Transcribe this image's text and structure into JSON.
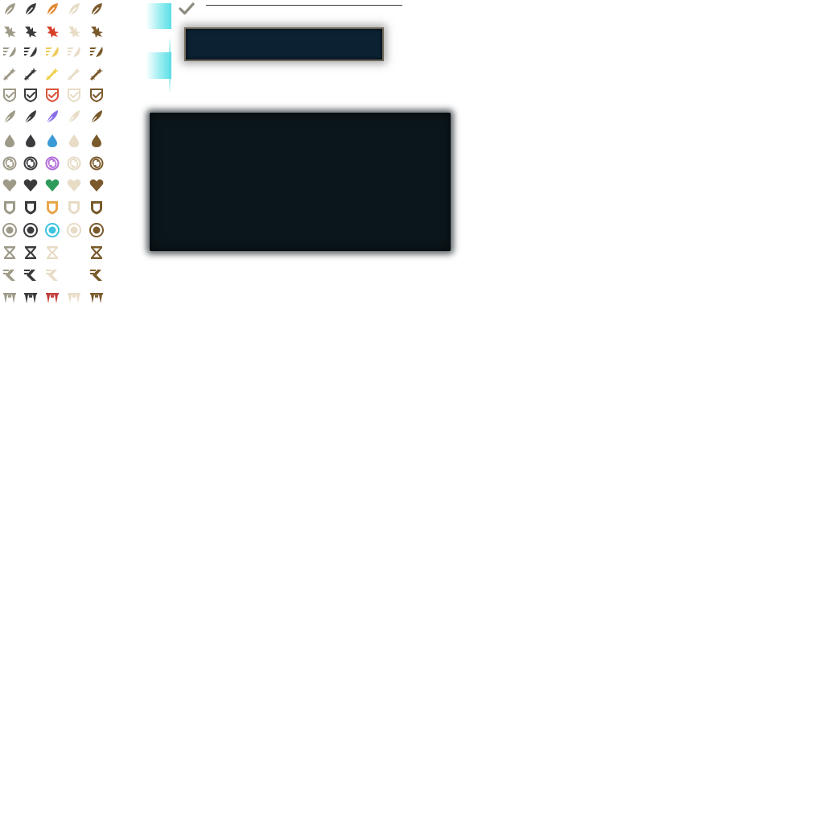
{
  "palette": {
    "tan": "#9e9a88",
    "dark": "#3b3b3e",
    "cream": "#e8dcc6",
    "brown": "#7a5a2c",
    "cyan": "#5fdde6",
    "panel_blue": "#0c2233",
    "panel_dark": "#0b161b"
  },
  "icon_rows": [
    {
      "name": "feather-quill",
      "colors": [
        "#9e9a88",
        "#3b3b3e",
        "#e38a35",
        "#e8dcc6",
        "#7a5a2c"
      ]
    },
    {
      "name": "impact-arrow",
      "colors": [
        "#9e9a88",
        "#3b3b3e",
        "#d9402a",
        "#e8dcc6",
        "#7a5a2c"
      ]
    },
    {
      "name": "speed-slash",
      "colors": [
        "#9e9a88",
        "#3b3b3e",
        "#f0c95a",
        "#e8dcc6",
        "#7a5a2c"
      ]
    },
    {
      "name": "sword-sparkle",
      "colors": [
        "#9e9a88",
        "#3b3b3e",
        "#efd04d",
        "#e8dcc6",
        "#7a5a2c"
      ]
    },
    {
      "name": "shield-check",
      "colors": [
        "#9e9a88",
        "#3b3b3e",
        "#d9543a",
        "#e8dcc6",
        "#7a5a2c"
      ]
    },
    {
      "name": "comet-feather",
      "colors": [
        "#9e9a88",
        "#3b3b3e",
        "#8a6fe8",
        "#e8dcc6",
        "#7a5a2c"
      ]
    },
    {
      "name": "water-drop",
      "colors": [
        "#9e9a88",
        "#3b3b3e",
        "#3a9ad6",
        "#e8dcc6",
        "#7a5a2c"
      ]
    },
    {
      "name": "cycle-arrows",
      "colors": [
        "#9e9a88",
        "#3b3b3e",
        "#b06ad8",
        "#e8dcc6",
        "#7a5a2c"
      ]
    },
    {
      "name": "heart",
      "colors": [
        "#9e9a88",
        "#3b3b3e",
        "#2e9a5c",
        "#e8dcc6",
        "#7a5a2c"
      ]
    },
    {
      "name": "shield-badge",
      "colors": [
        "#9e9a88",
        "#3b3b3e",
        "#e8a64a",
        "#e8dcc6",
        "#7a5a2c"
      ]
    },
    {
      "name": "target-ring",
      "colors": [
        "#9e9a88",
        "#3b3b3e",
        "#3ec3e0",
        "#e8dcc6",
        "#7a5a2c"
      ]
    },
    {
      "name": "hourglass",
      "colors": [
        "#9e9a88",
        "#3b3b3e",
        "#e8dcc6",
        "",
        "#7a5a2c"
      ]
    },
    {
      "name": "dash-chevron",
      "colors": [
        "#9e9a88",
        "#3b3b3e",
        "#e8dcc6",
        "",
        "#7a5a2c"
      ]
    },
    {
      "name": "fangs",
      "colors": [
        "#9e9a88",
        "#3b3b3e",
        "#c23a3a",
        "#e8dcc6",
        "#7a5a2c"
      ]
    }
  ],
  "check_icon": {
    "name": "checkmark-icon",
    "color": "#8e8a80"
  }
}
